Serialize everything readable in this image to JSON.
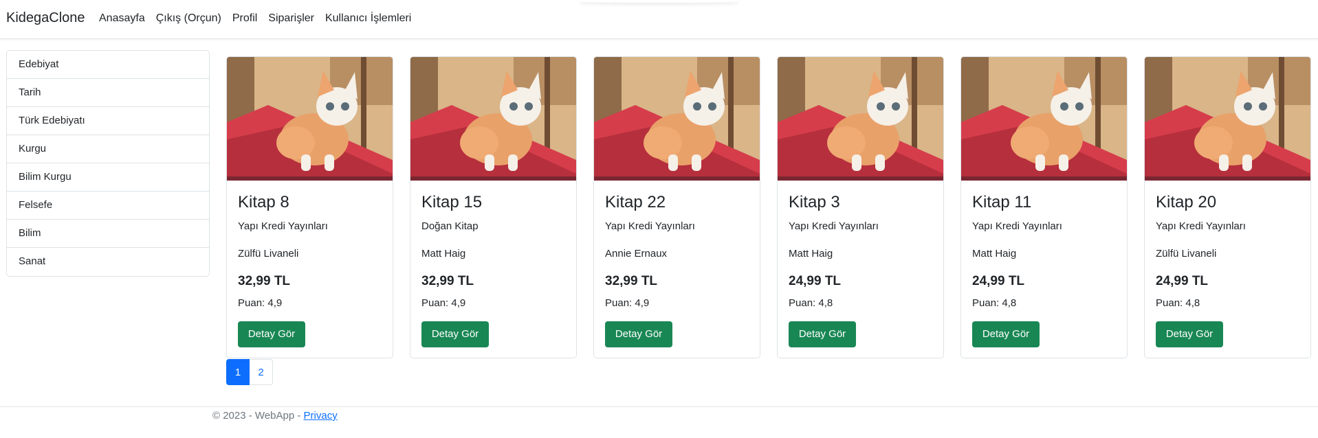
{
  "navbar": {
    "brand": "KidegaClone",
    "links": [
      "Anasayfa",
      "Çıkış (Orçun)",
      "Profil",
      "Siparişler",
      "Kullanıcı İşlemleri"
    ]
  },
  "sidebar": {
    "items": [
      "Edebiyat",
      "Tarih",
      "Türk Edebiyatı",
      "Kurgu",
      "Bilim Kurgu",
      "Felsefe",
      "Bilim",
      "Sanat"
    ]
  },
  "cards": [
    {
      "title": "Kitap 8",
      "publisher": "Yapı Kredi Yayınları",
      "author": "Zülfü Livaneli",
      "price": "32,99 TL",
      "rating": "Puan: 4,9",
      "button": "Detay Gör",
      "image": "kitten-photo"
    },
    {
      "title": "Kitap 15",
      "publisher": "Doğan Kitap",
      "author": "Matt Haig",
      "price": "32,99 TL",
      "rating": "Puan: 4,9",
      "button": "Detay Gör",
      "image": "kitten-photo"
    },
    {
      "title": "Kitap 22",
      "publisher": "Yapı Kredi Yayınları",
      "author": "Annie Ernaux",
      "price": "32,99 TL",
      "rating": "Puan: 4,9",
      "button": "Detay Gör",
      "image": "kitten-photo"
    },
    {
      "title": "Kitap 3",
      "publisher": "Yapı Kredi Yayınları",
      "author": "Matt Haig",
      "price": "24,99 TL",
      "rating": "Puan: 4,8",
      "button": "Detay Gör",
      "image": "kitten-photo"
    },
    {
      "title": "Kitap 11",
      "publisher": "Yapı Kredi Yayınları",
      "author": "Matt Haig",
      "price": "24,99 TL",
      "rating": "Puan: 4,8",
      "button": "Detay Gör",
      "image": "kitten-photo"
    },
    {
      "title": "Kitap 20",
      "publisher": "Yapı Kredi Yayınları",
      "author": "Zülfü Livaneli",
      "price": "24,99 TL",
      "rating": "Puan: 4,8",
      "button": "Detay Gör",
      "image": "kitten-photo"
    }
  ],
  "pagination": {
    "pages": [
      "1",
      "2"
    ],
    "active": "1"
  },
  "footer": {
    "text": "© 2023 - WebApp - ",
    "privacy_link": "Privacy"
  },
  "colors": {
    "primary": "#0d6efd",
    "success": "#198754",
    "border": "#dee2e6",
    "muted": "#6c757d"
  }
}
